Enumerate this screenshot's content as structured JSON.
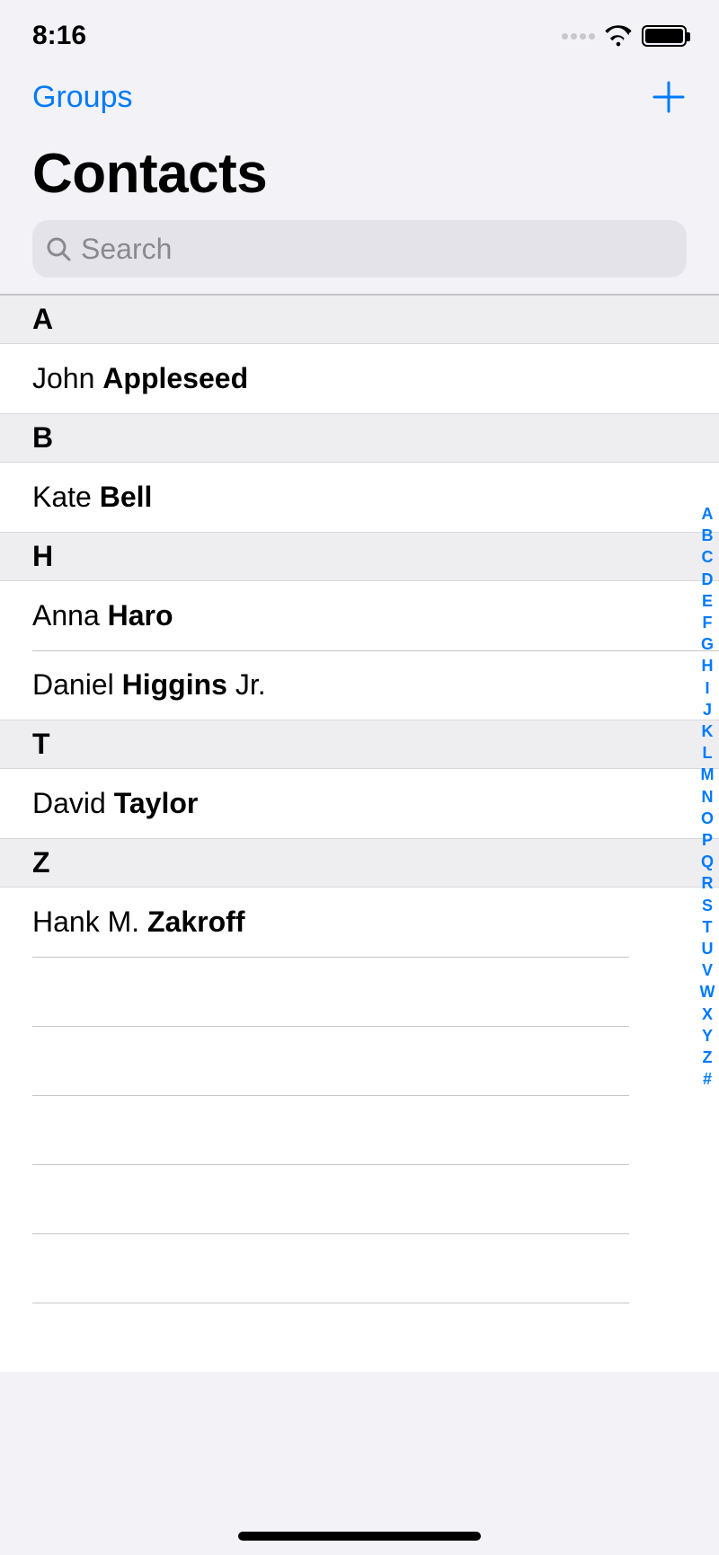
{
  "status": {
    "time": "8:16"
  },
  "nav": {
    "left_label": "Groups"
  },
  "title": "Contacts",
  "search": {
    "placeholder": "Search",
    "value": ""
  },
  "sections": [
    {
      "letter": "A",
      "items": [
        {
          "first": "John",
          "bold": "Appleseed",
          "suffix": ""
        }
      ]
    },
    {
      "letter": "B",
      "items": [
        {
          "first": "Kate",
          "bold": "Bell",
          "suffix": ""
        }
      ]
    },
    {
      "letter": "H",
      "items": [
        {
          "first": "Anna",
          "bold": "Haro",
          "suffix": ""
        },
        {
          "first": "Daniel",
          "bold": "Higgins",
          "suffix": "Jr."
        }
      ]
    },
    {
      "letter": "T",
      "items": [
        {
          "first": "David",
          "bold": "Taylor",
          "suffix": ""
        }
      ]
    },
    {
      "letter": "Z",
      "items": [
        {
          "first": "Hank M.",
          "bold": "Zakroff",
          "suffix": ""
        }
      ]
    }
  ],
  "empty_rows": 6,
  "index": [
    "A",
    "B",
    "C",
    "D",
    "E",
    "F",
    "G",
    "H",
    "I",
    "J",
    "K",
    "L",
    "M",
    "N",
    "O",
    "P",
    "Q",
    "R",
    "S",
    "T",
    "U",
    "V",
    "W",
    "X",
    "Y",
    "Z",
    "#"
  ]
}
